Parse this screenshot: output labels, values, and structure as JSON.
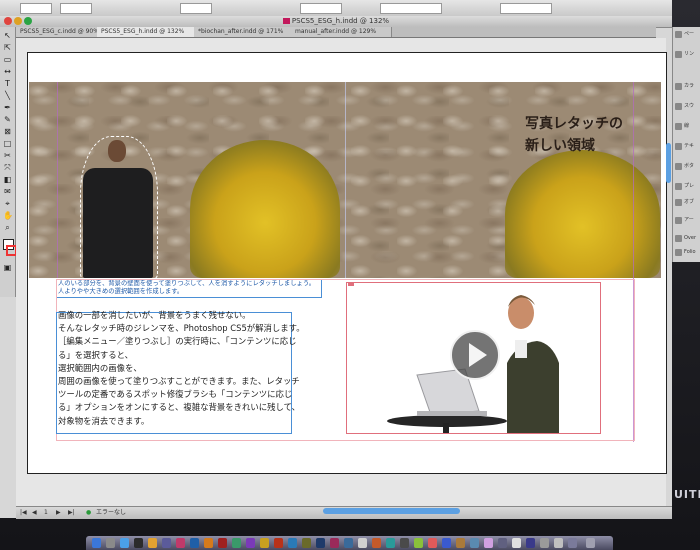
{
  "window": {
    "document_title": "PSCS5_ESG_h.indd @ 132%"
  },
  "tabs": [
    {
      "label": "PSCS5_ESG_c.indd @ 90%"
    },
    {
      "label": "PSCS5_ESG_h.indd @ 132%"
    },
    {
      "label": "*biochan_after.indd @ 171%"
    },
    {
      "label": "manual_after.indd @ 129%"
    }
  ],
  "page": {
    "headline_line1": "写真レタッチの",
    "headline_line2": "新しい領域",
    "caption_line1": "人のいる部分を、背景の壁面を使って塗りつぶして、人を消すようにレタッチしましょう。",
    "caption_line2": "人よりやや大きめの選択範囲を作成します。",
    "body_lines": [
      "画像の一部を消したいが、背景をうまく残せない。",
      "そんなレタッチ時のジレンマを、Photoshop CS5が解消します。",
      "［編集メニュー／塗りつぶし］の実行時に、「コンテンツに応じ",
      "る」を選択すると、",
      "選択範囲内の画像を、",
      "周囲の画像を使って塗りつぶすことができます。また、レタッチ",
      "ツールの定番であるスポット修復ブラシも「コンテンツに応じ",
      "る」オプションをオンにすると、複雑な背景をきれいに残して、",
      "対象物を消去できます。"
    ]
  },
  "panels": [
    {
      "label": "ペー",
      "icon": "pages-icon"
    },
    {
      "label": "リン",
      "icon": "links-icon"
    },
    {
      "label": "カラ",
      "icon": "color-icon"
    },
    {
      "label": "スウ",
      "icon": "swatches-icon"
    },
    {
      "label": "線",
      "icon": "stroke-icon"
    },
    {
      "label": "テキ",
      "icon": "text-wrap-icon"
    },
    {
      "label": "ボタ",
      "icon": "buttons-icon"
    },
    {
      "label": "プレ",
      "icon": "preview-icon"
    },
    {
      "label": "オブ",
      "icon": "object-icon"
    },
    {
      "label": "アー",
      "icon": "articles-icon"
    },
    {
      "label": "Over",
      "icon": "overset-icon"
    },
    {
      "label": "Folio",
      "icon": "folio-icon"
    }
  ],
  "status": {
    "page_number": "1",
    "preflight": "エラーなし"
  },
  "brand_text": "UITE",
  "colors": {
    "frame_blue": "#4a8fd6",
    "frame_red": "#e06f7c",
    "scrollbar": "#5ca0e2",
    "guide_purple": "#b36bc2"
  }
}
